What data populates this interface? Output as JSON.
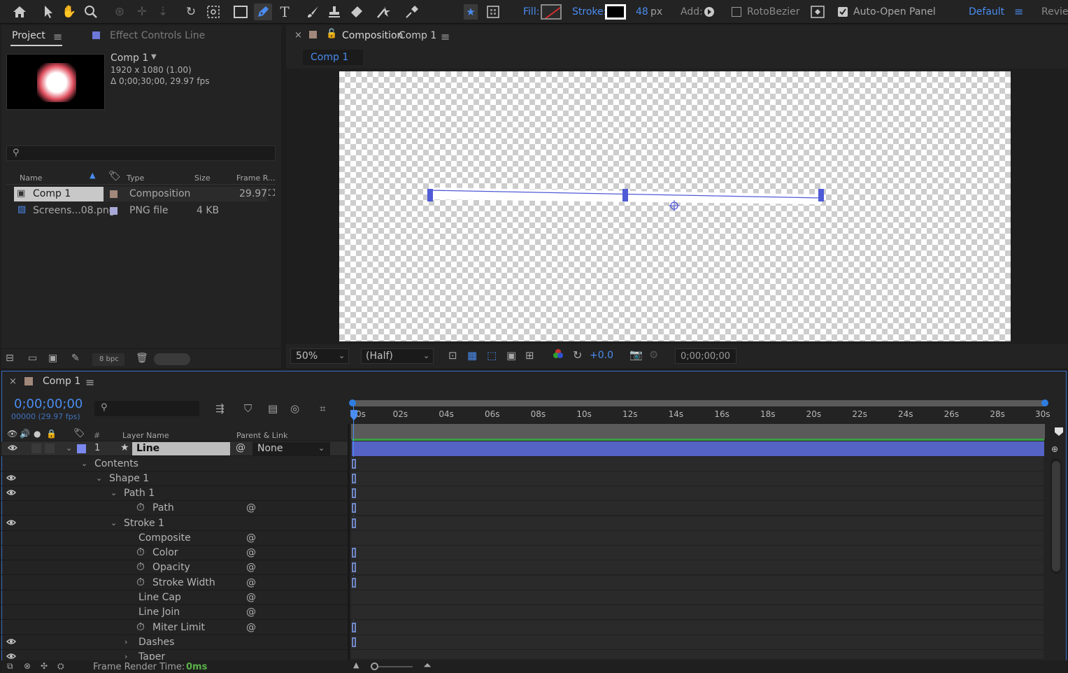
{
  "toolbar": {
    "fill_label": "Fill:",
    "stroke_label": "Stroke:",
    "stroke_width": "48",
    "stroke_unit": "px",
    "add_label": "Add:",
    "rotobezier_label": "RotoBezier",
    "auto_open_label": "Auto-Open Panel",
    "workspace": "Default",
    "review": "Review"
  },
  "project": {
    "tab_label": "Project",
    "effect_controls_label": "Effect Controls Line",
    "comp_name": "Comp 1",
    "comp_size": "1920 x 1080 (1.00)",
    "comp_duration": "Δ 0;00;30;00, 29.97 fps",
    "columns": {
      "name": "Name",
      "type": "Type",
      "size": "Size",
      "frame_rate": "Frame R..."
    },
    "items": [
      {
        "name": "Comp 1",
        "type": "Composition",
        "size": "",
        "frame_rate": "29.97"
      },
      {
        "name": "Screens...08.png",
        "type": "PNG file",
        "size": "4 KB",
        "frame_rate": ""
      }
    ],
    "bpc": "8 bpc"
  },
  "composition": {
    "tab_prefix": "Composition",
    "tab_comp": "Comp 1",
    "sub_tab": "Comp 1",
    "zoom": "50%",
    "resolution": "(Half)",
    "exposure": "+0.0",
    "timecode": "0;00;00;00"
  },
  "timeline": {
    "tab_label": "Comp 1",
    "timecode": "0;00;00;00",
    "frames": "00000 (29.97 fps)",
    "col_num": "#",
    "col_layer_name": "Layer Name",
    "col_parent": "Parent & Link",
    "layer_number": "1",
    "layer_name": "Line",
    "parent_value": "None",
    "ticks": [
      "0s",
      "02s",
      "04s",
      "06s",
      "08s",
      "10s",
      "12s",
      "14s",
      "16s",
      "18s",
      "20s",
      "22s",
      "24s",
      "26s",
      "28s",
      "30s"
    ],
    "properties": {
      "contents": "Contents",
      "shape1": "Shape 1",
      "path1": "Path 1",
      "path": "Path",
      "stroke1": "Stroke 1",
      "composite": "Composite",
      "color": "Color",
      "opacity": "Opacity",
      "stroke_width": "Stroke Width",
      "line_cap": "Line Cap",
      "line_join": "Line Join",
      "miter_limit": "Miter Limit",
      "dashes": "Dashes",
      "taper": "Taper"
    },
    "frame_render_label": "Frame Render Time:",
    "frame_render_value": "0ms"
  }
}
